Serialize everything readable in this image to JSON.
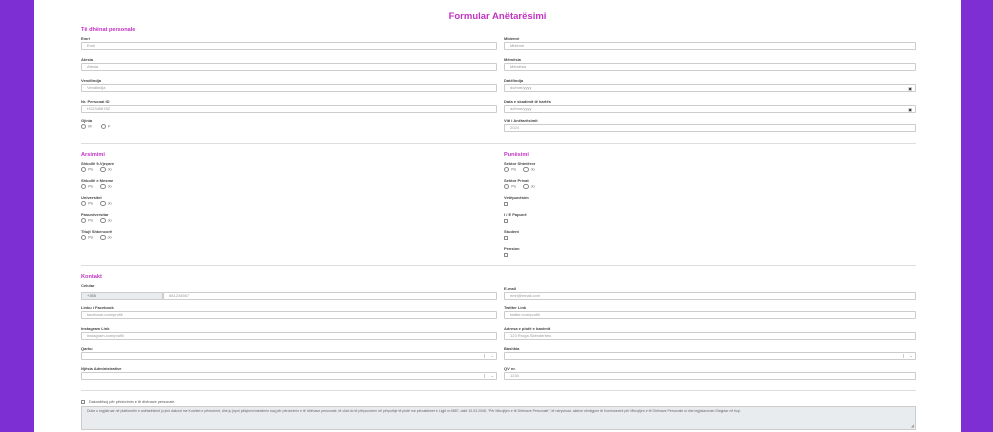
{
  "title": "Formular Anëtarësimi",
  "personal": {
    "heading": "Të dhënat personale",
    "emri": {
      "label": "Emri",
      "placeholder": "Emri"
    },
    "mbiemri": {
      "label": "Mbiemri",
      "placeholder": "Mbiemri"
    },
    "atesia": {
      "label": "Atesia",
      "placeholder": "Atesia"
    },
    "memesia": {
      "label": "Mëmësia",
      "placeholder": "Mëmësia"
    },
    "vendlindja": {
      "label": "Vendlindja",
      "placeholder": "Vendlindja"
    },
    "datelindja": {
      "label": "Datëlindja",
      "placeholder": "dd/mm/yyyy"
    },
    "nr_personal": {
      "label": "Nr. Personal ID",
      "placeholder": "H12345678Z"
    },
    "data_dokument": {
      "label": "Data e skadimit të kartës",
      "placeholder": "dd/mm/yyyy"
    },
    "gjinia": {
      "label": "Gjinia",
      "options": [
        "M",
        "F"
      ]
    },
    "viti": {
      "label": "Viti i Anëtarësimit",
      "value": "2024"
    }
  },
  "arsimimi": {
    "heading": "Arsimimi",
    "groups": [
      {
        "label": "Shkollë 9-Vjeçare",
        "yes": "Po",
        "no": "Jo"
      },
      {
        "label": "Shkollë e Mesme",
        "yes": "Po",
        "no": "Jo"
      },
      {
        "label": "Universitet",
        "yes": "Po",
        "no": "Jo"
      },
      {
        "label": "Pasuniversitar",
        "yes": "Po",
        "no": "Jo"
      },
      {
        "label": "Titujt Shkencorë",
        "yes": "Po",
        "no": "Jo"
      }
    ]
  },
  "punesimi": {
    "heading": "Punësimi",
    "radio_groups": [
      {
        "label": "Sektor Shtetëror",
        "yes": "Po",
        "no": "Jo"
      },
      {
        "label": "Sektor Privat",
        "yes": "Po",
        "no": "Jo"
      }
    ],
    "checks": [
      "Vetëpunësim",
      "I / E Papunë",
      "Student",
      "Pension"
    ]
  },
  "kontakt": {
    "heading": "Kontakt",
    "celular": {
      "label": "Celular",
      "prefix": "+355",
      "placeholder": "681234567"
    },
    "email": {
      "label": "E-mail",
      "placeholder": "emri@email.com"
    },
    "facebook": {
      "label": "Linku i Facebook",
      "placeholder": "facebook.com/profili"
    },
    "twitter": {
      "label": "Twitter Link",
      "placeholder": "twitter.com/profili"
    },
    "instagram": {
      "label": "Instagram Link",
      "placeholder": "instagram.com/profili"
    },
    "adresa": {
      "label": "Adresa e plotë e banimit",
      "placeholder": "123 Rruga Skënderbeu"
    },
    "qarku": {
      "label": "Qarku",
      "value": ""
    },
    "bashkia": {
      "label": "Bashkia",
      "value": "-"
    },
    "njesia": {
      "label": "Njësia Administrative",
      "value": ""
    },
    "qv": {
      "label": "QV nr.",
      "placeholder": "1234"
    }
  },
  "consent": {
    "label": "Dakordësoj për përdorimin e të dhënave personale",
    "text": "Duke u regjistruar në platformën e anëtarësimit ju jeni dakord me Kushtet e përdorimit, dhe ju jepni pëlqimin/miratimin tuaj për përdorimin e të dhënave personale, të cilat do të përpunohen në përputhje të plotë me përcaktimet e Ligjit nr.9887, datë 10.03.2008, \"Për Mbrojtjen e të Dhënave Personale\", të ndryshuar, akteve nënligjore të Komisionerit për Mbrojtjen e të Dhënave Personale si dhe legjislacionin Shqiptar në fuqi."
  }
}
